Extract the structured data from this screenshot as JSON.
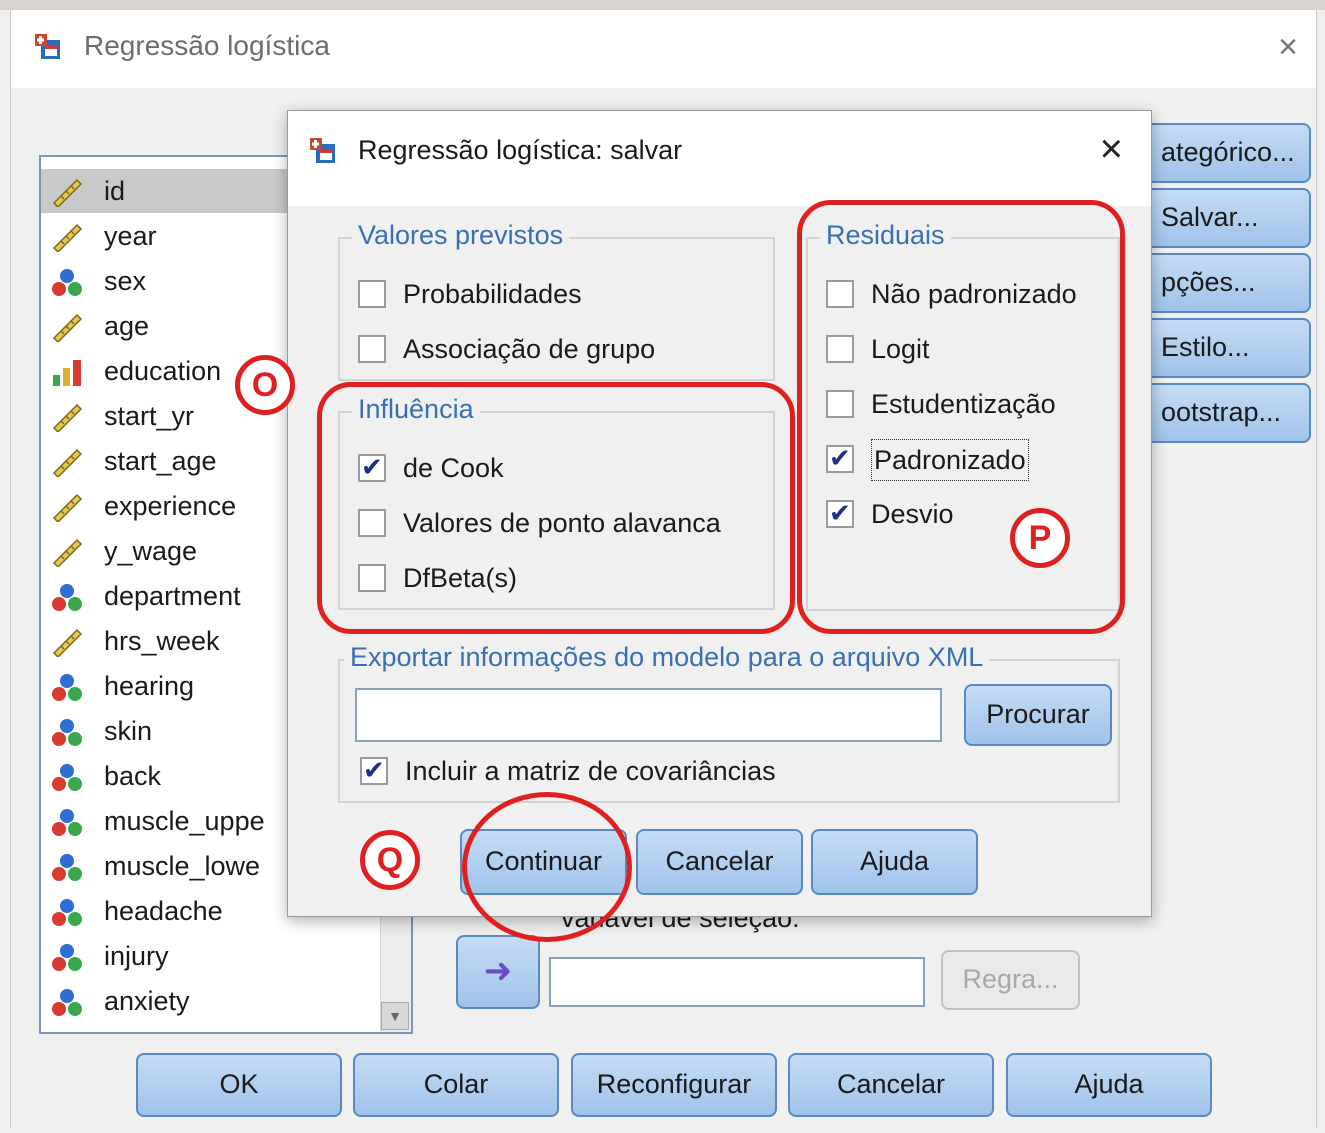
{
  "main_dialog": {
    "title": "Regressão logística",
    "close_symbol": "×"
  },
  "variables": [
    {
      "name": "id",
      "type": "scale"
    },
    {
      "name": "year",
      "type": "scale"
    },
    {
      "name": "sex",
      "type": "nominal"
    },
    {
      "name": "age",
      "type": "scale"
    },
    {
      "name": "education",
      "type": "ordinal"
    },
    {
      "name": "start_yr",
      "type": "scale"
    },
    {
      "name": "start_age",
      "type": "scale"
    },
    {
      "name": "experience",
      "type": "scale"
    },
    {
      "name": "y_wage",
      "type": "scale"
    },
    {
      "name": "department",
      "type": "nominal"
    },
    {
      "name": "hrs_week",
      "type": "scale"
    },
    {
      "name": "hearing",
      "type": "nominal"
    },
    {
      "name": "skin",
      "type": "nominal"
    },
    {
      "name": "back",
      "type": "nominal"
    },
    {
      "name": "muscle_uppe",
      "type": "nominal"
    },
    {
      "name": "muscle_lowe",
      "type": "nominal"
    },
    {
      "name": "headache",
      "type": "nominal"
    },
    {
      "name": "injury",
      "type": "nominal"
    },
    {
      "name": "anxiety",
      "type": "nominal"
    }
  ],
  "side_buttons": {
    "categorical": "ategórico...",
    "save": "Salvar...",
    "options": "pções...",
    "style": "Estilo...",
    "bootstrap": "ootstrap..."
  },
  "selection": {
    "label": "variável de seleção:",
    "rule_button": "Regra..."
  },
  "bottom_buttons": {
    "ok": "OK",
    "paste": "Colar",
    "reset": "Reconfigurar",
    "cancel": "Cancelar",
    "help": "Ajuda"
  },
  "save_dialog": {
    "title": "Regressão logística: salvar",
    "close_symbol": "×",
    "predicted_values": {
      "legend": "Valores previstos",
      "probabilities": {
        "label": "Probabilidades",
        "checked": false
      },
      "group_membership": {
        "label": "Associação de grupo",
        "checked": false
      }
    },
    "influence": {
      "legend": "Influência",
      "cooks": {
        "label": "de Cook",
        "checked": true
      },
      "leverage": {
        "label": "Valores de ponto alavanca",
        "checked": false
      },
      "dfbeta": {
        "label": "DfBeta(s)",
        "checked": false
      }
    },
    "residuals": {
      "legend": "Residuais",
      "unstandardized": {
        "label": "Não padronizado",
        "checked": false
      },
      "logit": {
        "label": "Logit",
        "checked": false
      },
      "studentized": {
        "label": "Estudentização",
        "checked": false
      },
      "standardized": {
        "label": "Padronizado",
        "checked": true
      },
      "deviance": {
        "label": "Desvio",
        "checked": true
      }
    },
    "export": {
      "legend": "Exportar informações do modelo para o arquivo XML",
      "path_value": "",
      "browse_button": "Procurar",
      "include_covariance": {
        "label": "Incluir a matriz de covariâncias",
        "checked": true
      }
    },
    "buttons": {
      "continue": "Continuar",
      "cancel": "Cancelar",
      "help": "Ajuda"
    }
  },
  "annotations": {
    "influence_badge": "O",
    "residuals_badge": "P",
    "continue_badge": "Q",
    "color": "#e02020"
  }
}
